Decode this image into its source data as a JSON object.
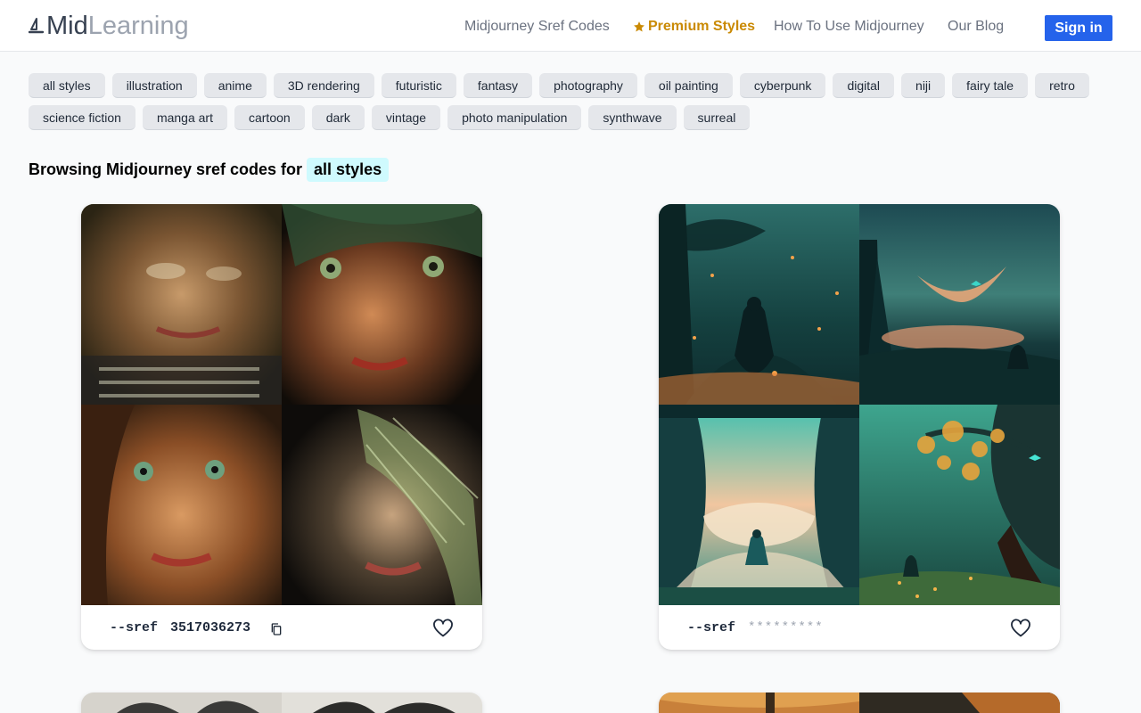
{
  "header": {
    "logo_mid": "Mid",
    "logo_learning": "Learning",
    "nav": [
      {
        "label": "Midjourney Sref Codes"
      },
      {
        "label": "Premium Styles"
      },
      {
        "label": "How To Use Midjourney"
      },
      {
        "label": "Our Blog"
      }
    ],
    "signin_label": "Sign in"
  },
  "tags": [
    "all styles",
    "illustration",
    "anime",
    "3D rendering",
    "futuristic",
    "fantasy",
    "photography",
    "oil painting",
    "cyberpunk",
    "digital",
    "niji",
    "fairy tale",
    "retro",
    "science fiction",
    "manga art",
    "cartoon",
    "dark",
    "vintage",
    "photo manipulation",
    "synthwave",
    "surreal"
  ],
  "browsing": {
    "prefix": "Browsing Midjourney sref codes for",
    "active_style": "all styles"
  },
  "cards": [
    {
      "sref_label": "--sref",
      "code": "3517036273"
    },
    {
      "sref_label": "--sref",
      "code_masked": "*********"
    }
  ],
  "colors": {
    "accent": "#2563eb",
    "premium": "#ca8a04",
    "highlight": "#cffafe",
    "tag_bg": "#e5e7eb"
  },
  "icons": [
    "sailboat-logo-icon",
    "star-icon",
    "copy-icon",
    "heart-icon"
  ]
}
